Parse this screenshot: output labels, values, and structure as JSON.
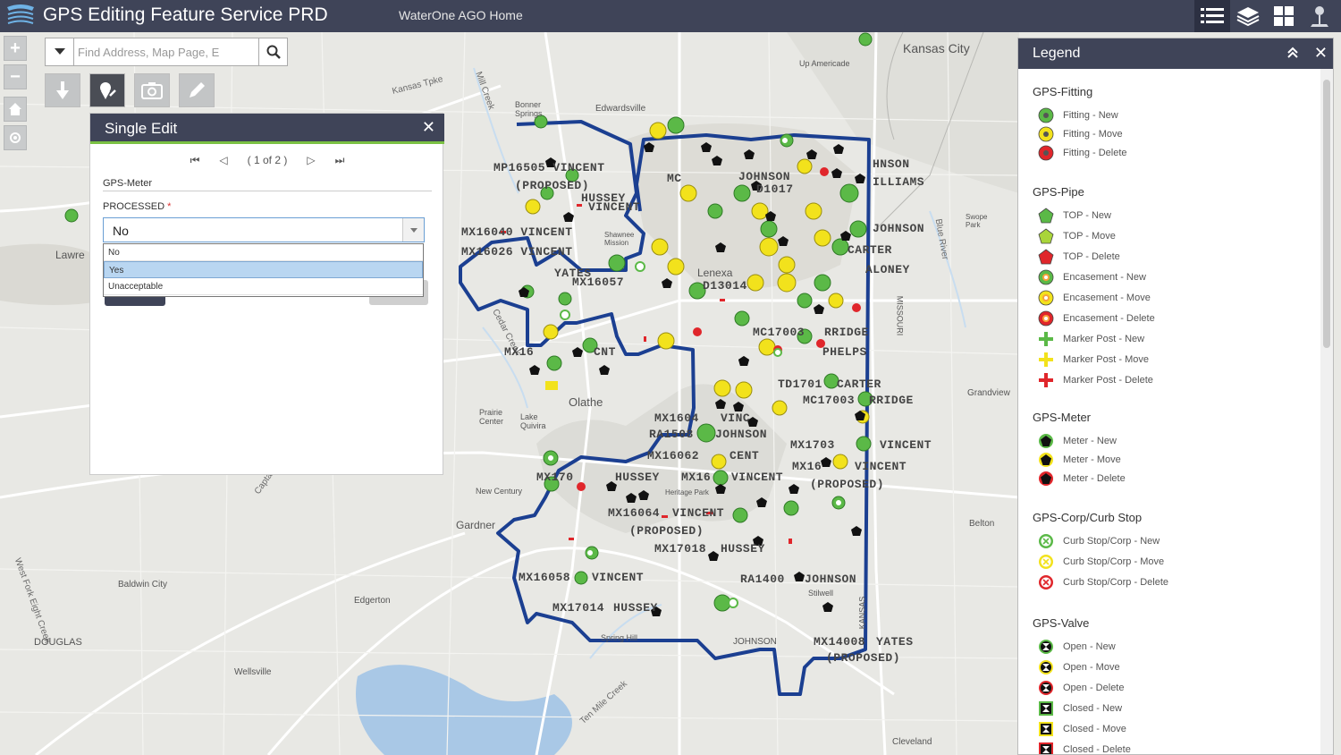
{
  "header": {
    "title": "GPS Editing Feature Service PRD",
    "home_link": "WaterOne AGO Home",
    "buttons": [
      "list-icon",
      "layers-icon",
      "grid-icon",
      "location-icon"
    ]
  },
  "search": {
    "placeholder": "Find Address, Map Page, E"
  },
  "toolbar": [
    "gps-pin-icon",
    "edit-pin-icon",
    "camera-icon",
    "pencil-icon"
  ],
  "single_edit": {
    "title": "Single Edit",
    "pager": "( 1 of 2 )",
    "layer": "GPS-Meter",
    "field_label": "PROCESSED",
    "required_mark": "*",
    "value": "No",
    "options": [
      {
        "label": "No",
        "selected": false
      },
      {
        "label": "Yes",
        "selected": true
      },
      {
        "label": "Unacceptable",
        "selected": false
      }
    ]
  },
  "legend": {
    "title": "Legend",
    "groups": [
      {
        "name": "GPS-Fitting",
        "items": [
          {
            "label": "Fitting - New",
            "symbol": "circle-dot",
            "color": "#5bb947"
          },
          {
            "label": "Fitting - Move",
            "symbol": "circle-dot",
            "color": "#f2e21c"
          },
          {
            "label": "Fitting - Delete",
            "symbol": "circle-dot",
            "color": "#e0262b"
          }
        ]
      },
      {
        "name": "GPS-Pipe",
        "items": [
          {
            "label": "TOP - New",
            "symbol": "pentagon",
            "color": "#5bb947"
          },
          {
            "label": "TOP - Move",
            "symbol": "pentagon",
            "color": "#a9d53a"
          },
          {
            "label": "TOP - Delete",
            "symbol": "pentagon",
            "color": "#e0262b"
          },
          {
            "label": "Encasement - New",
            "symbol": "ring",
            "color": "#5bb947"
          },
          {
            "label": "Encasement - Move",
            "symbol": "ring",
            "color": "#f2e21c"
          },
          {
            "label": "Encasement - Delete",
            "symbol": "ring",
            "color": "#e0262b"
          },
          {
            "label": "Marker Post - New",
            "symbol": "cross",
            "color": "#5bb947"
          },
          {
            "label": "Marker Post - Move",
            "symbol": "cross",
            "color": "#f2e21c"
          },
          {
            "label": "Marker Post - Delete",
            "symbol": "cross",
            "color": "#e0262b"
          }
        ]
      },
      {
        "name": "GPS-Meter",
        "items": [
          {
            "label": "Meter - New",
            "symbol": "pentagon-dark",
            "color": "#5bb947"
          },
          {
            "label": "Meter - Move",
            "symbol": "pentagon-dark",
            "color": "#f2e21c"
          },
          {
            "label": "Meter - Delete",
            "symbol": "pentagon-dark",
            "color": "#e0262b"
          }
        ]
      },
      {
        "name": "GPS-Corp/Curb Stop",
        "items": [
          {
            "label": "Curb Stop/Corp - New",
            "symbol": "target",
            "color": "#5bb947"
          },
          {
            "label": "Curb Stop/Corp - Move",
            "symbol": "target",
            "color": "#f2e21c"
          },
          {
            "label": "Curb Stop/Corp - Delete",
            "symbol": "target",
            "color": "#e0262b"
          }
        ]
      },
      {
        "name": "GPS-Valve",
        "items": [
          {
            "label": "Open - New",
            "symbol": "valve-open",
            "color": "#5bb947"
          },
          {
            "label": "Open - Move",
            "symbol": "valve-open",
            "color": "#f2e21c"
          },
          {
            "label": "Open - Delete",
            "symbol": "valve-open",
            "color": "#e0262b"
          },
          {
            "label": "Closed - New",
            "symbol": "valve-closed",
            "color": "#5bb947"
          },
          {
            "label": "Closed - Move",
            "symbol": "valve-closed",
            "color": "#f2e21c"
          },
          {
            "label": "Closed - Delete",
            "symbol": "valve-closed",
            "color": "#e0262b"
          }
        ]
      }
    ]
  },
  "map": {
    "cities": [
      "Kansas City",
      "Olathe",
      "Lenexa",
      "Gardner",
      "Baldwin City",
      "Edgerton",
      "Wellsville",
      "DOUGLAS",
      "Lawre",
      "Cleveland",
      "Belton",
      "Grandview",
      "Up Americade",
      "Edwardsville",
      "Bonner Springs",
      "Prairie Center",
      "Lake Quivira",
      "New Century",
      "Spring Hill",
      "Shawnee Mission",
      "Swope Park",
      "JOHNSON",
      "MISSOURI",
      "KANSAS",
      "Heritage Park",
      "Stilwell"
    ],
    "roads": [
      "Kansas Tpke",
      "Cedar Creek",
      "Captain",
      "West Fork Eight Creek",
      "Ten Mile Creek",
      "Blue River",
      "Mill Creek"
    ],
    "labels": [
      "MP16505 VINCENT",
      "(PROPOSED)",
      "HUSSEY",
      "VINCENT",
      "MX16040 VINCENT",
      "MX16026 VINCENT",
      "YATES",
      "MX16057",
      "MC",
      "JOHNSON",
      "D1017",
      "HNSON",
      "ILLIAMS",
      "JOHNSON",
      "CARTER",
      "ALONEY",
      "MX16",
      "CNT",
      "D13014",
      "MC17003",
      "RRIDGE",
      "PHELPS",
      "TD1701",
      "CARTER",
      "MC17003",
      "RRIDGE",
      "MX1604",
      "VINC",
      "RA1508",
      "JOHNSON",
      "MX16062",
      "CENT",
      "MX1703",
      "VINCENT",
      "MX16",
      "VINCENT",
      "(PROPOSED)",
      "MX170",
      "HUSSEY",
      "MX16",
      "VINCENT",
      "MX16064",
      "VINCENT",
      "(PROPOSED)",
      "MX17018",
      "HUSSEY",
      "MX16058",
      "VINCENT",
      "RA1400",
      "JOHNSON",
      "MX17014",
      "HUSSEY",
      "MX14008",
      "YATES",
      "(PROPOSED)"
    ]
  }
}
